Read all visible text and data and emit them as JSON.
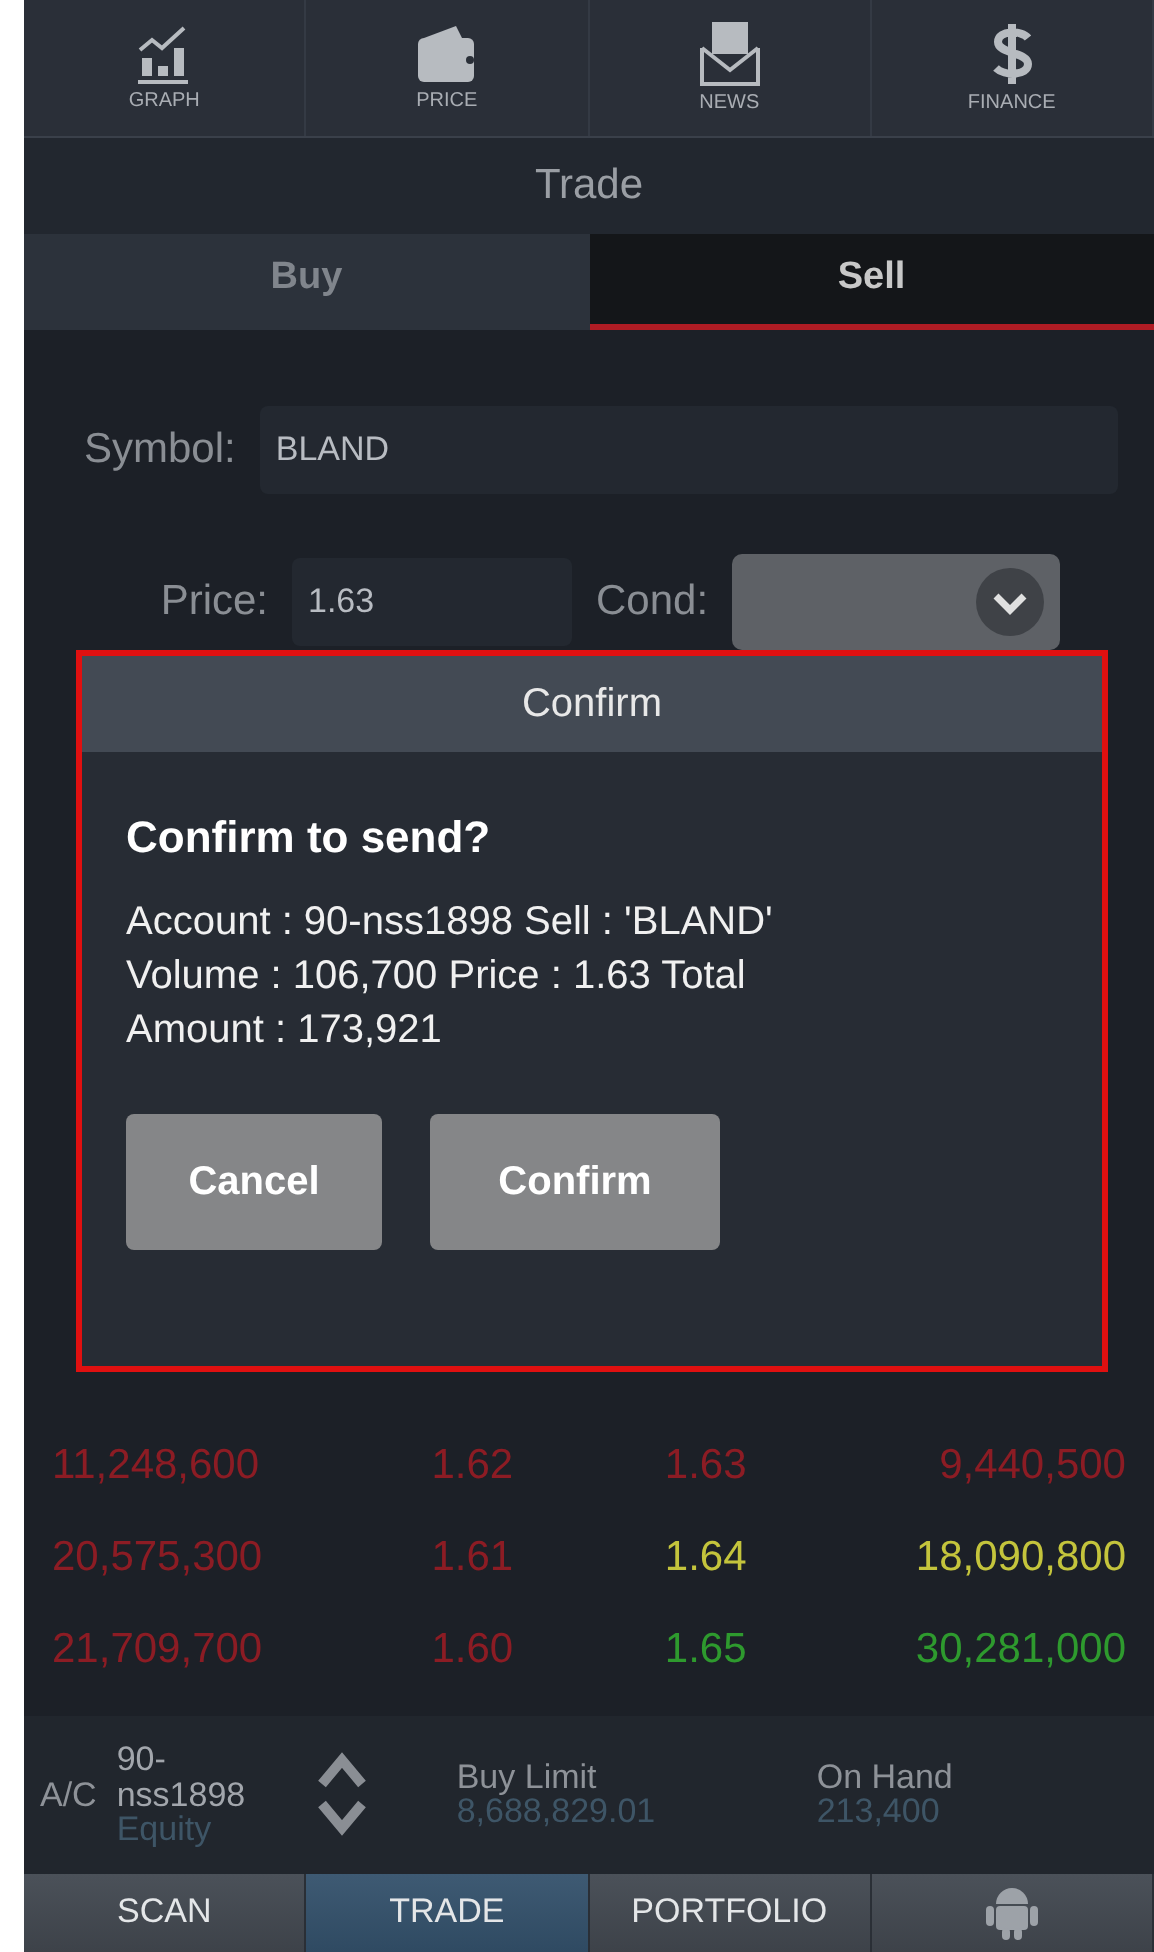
{
  "top_nav": [
    {
      "kind": "graph",
      "label": "GRAPH"
    },
    {
      "kind": "price",
      "label": "PRICE"
    },
    {
      "kind": "news",
      "label": "NEWS"
    },
    {
      "kind": "finance",
      "label": "FINANCE"
    }
  ],
  "title": "Trade",
  "tabs": [
    {
      "label": "Buy",
      "selected": false
    },
    {
      "label": "Sell",
      "selected": true
    }
  ],
  "form": {
    "symbol_label": "Symbol:",
    "symbol_value": "BLAND",
    "price_label": "Price:",
    "price_value": "1.63",
    "cond_label": "Cond:"
  },
  "table": {
    "rows": [
      {
        "cells": [
          {
            "text": "11,248,600",
            "color": "#8c1c24"
          },
          {
            "text": "1.62",
            "color": "#8c1c24"
          },
          {
            "text": "1.63",
            "color": "#8c1c24"
          },
          {
            "text": "9,440,500",
            "color": "#8c1c24"
          }
        ]
      },
      {
        "cells": [
          {
            "text": "20,575,300",
            "color": "#8c1c24"
          },
          {
            "text": "1.61",
            "color": "#8c1c24"
          },
          {
            "text": "1.64",
            "color": "#c4c43c"
          },
          {
            "text": "18,090,800",
            "color": "#c4c43c"
          }
        ]
      },
      {
        "cells": [
          {
            "text": "21,709,700",
            "color": "#8c1c24"
          },
          {
            "text": "1.60",
            "color": "#8c1c24"
          },
          {
            "text": "1.65",
            "color": "#2e9a2e"
          },
          {
            "text": "30,281,000",
            "color": "#2e9a2e"
          }
        ]
      }
    ]
  },
  "account_bar": {
    "label": "A/C",
    "account": "90-nss1898",
    "type": "Equity",
    "buy_limit_label": "Buy Limit",
    "buy_limit": "8,688,829.01",
    "on_hand_label": "On Hand",
    "on_hand": "213,400"
  },
  "bottom_tabs": [
    {
      "kind": "text",
      "label": "SCAN",
      "selected": false
    },
    {
      "kind": "text",
      "label": "TRADE",
      "selected": true
    },
    {
      "kind": "text",
      "label": "PORTFOLIO",
      "selected": false
    },
    {
      "kind": "android",
      "selected": false
    }
  ],
  "dialog": {
    "title": "Confirm",
    "heading": "Confirm to send?",
    "message_lines": [
      "Account : 90-nss1898 Sell : 'BLAND'",
      "Volume : 106,700 Price : 1.63 Total",
      "Amount : 173,921"
    ],
    "buttons": [
      "Cancel",
      "Confirm"
    ]
  }
}
